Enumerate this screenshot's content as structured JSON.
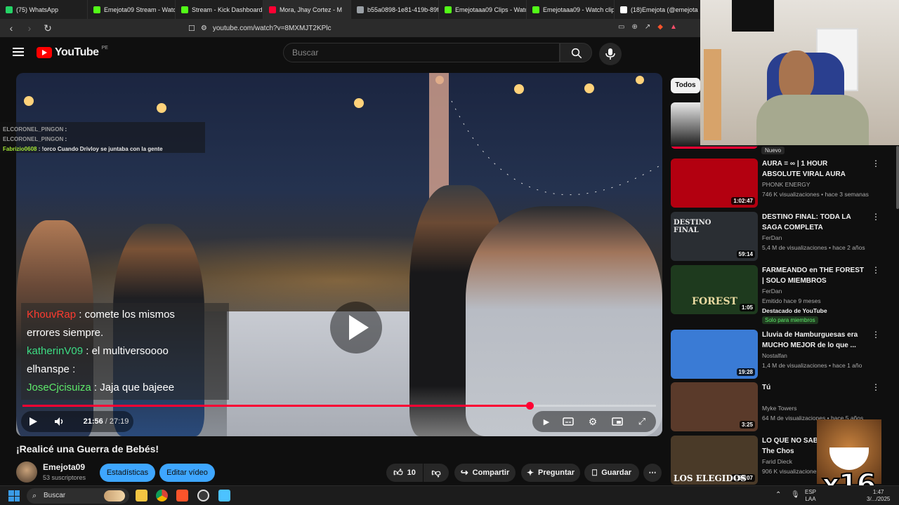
{
  "browser": {
    "tabs": [
      {
        "label": "(75) WhatsApp",
        "color": "#25d366"
      },
      {
        "label": "Emejota09 Stream - Watch",
        "color": "#53fc18"
      },
      {
        "label": "Stream - Kick Dashboard",
        "color": "#53fc18"
      },
      {
        "label": "Mora, Jhay Cortez - M",
        "color": "#ff0033"
      },
      {
        "label": "b55a0898-1e81-419b-89f",
        "color": "#9aa0a6"
      },
      {
        "label": "Emejotaaa09 Clips - Watch",
        "color": "#53fc18"
      },
      {
        "label": "Emejotaaa09 - Watch clip",
        "color": "#53fc18"
      },
      {
        "label": "(18)Emejota (@emejota",
        "color": "#ffffff"
      }
    ],
    "url": "youtube.com/watch?v=8MXMJT2KPlc"
  },
  "youtube": {
    "logo_text": "YouTube",
    "country_code": "PE",
    "search_placeholder": "Buscar"
  },
  "player": {
    "current_time": "21:56",
    "total_time": "27:19",
    "progress": 0.8,
    "time_separator": "/"
  },
  "overlay_chat_small": [
    {
      "user": "ELCORONEL_PINGON",
      "text": ":",
      "color": "#9b9b9b"
    },
    {
      "user": "ELCORONEL_PINGON",
      "text": ":",
      "color": "#9b9b9b"
    },
    {
      "user": "Fabrizio0608",
      "text": ": !orco Cuando Drivloy se juntaba con la gente",
      "color": "#a3e635"
    }
  ],
  "overlay_chat_big": [
    {
      "user": "KhouvRap",
      "text": ": comete los mismos",
      "color": "#ff3b30"
    },
    {
      "user": "",
      "text": "errores siempre.",
      "color": "#ffffff"
    },
    {
      "user": "katherinV09",
      "text": ": el multiversoooo",
      "color": "#3ddc84"
    },
    {
      "user": "elhanspe",
      "text": ":",
      "color": "#ffffff"
    },
    {
      "user": "JoseCjcisuiza",
      "text": ": Jaja que bajeee",
      "color": "#5ee86a"
    }
  ],
  "video": {
    "title": "¡Realicé una Guerra de Bebés!",
    "channel": "Emejota09",
    "subscribers": "53 suscriptores",
    "stats_button": "Estadísticas",
    "edit_button": "Editar vídeo",
    "likes": "10",
    "share_label": "Compartir",
    "ask_label": "Preguntar",
    "save_label": "Guardar"
  },
  "sidebar": {
    "chip": "Todos",
    "new_badge": "Nuevo",
    "items": [
      {
        "title": "AURA = ∞ | 1 HOUR ABSOLUTE VIRAL AURA MUSI...",
        "channel": "PHONK ENERGY",
        "meta": "746 K visualizaciones • hace 3 semanas",
        "duration": "1:02:47",
        "thumb": "#b30010"
      },
      {
        "title": "DESTINO FINAL: TODA LA SAGA COMPLETA",
        "channel": "FerDan",
        "meta": "5,4 M de visualizaciones • hace 2 años",
        "duration": "59:14",
        "thumb": "#2a2e33"
      },
      {
        "title": "FARMEANDO en THE FOREST | SOLO MIEMBROS",
        "channel": "FerDan",
        "meta": "Emitido hace 9 meses",
        "duration": "1:05",
        "thumb": "#1e3a1e",
        "extra": "Destacado de YouTube",
        "badge": "Solo para miembros"
      },
      {
        "title": "Lluvia de Hamburguesas era MUCHO MEJOR de lo que ...",
        "channel": "Nostalfan",
        "meta": "1,4 M de visualizaciones • hace 1 año",
        "duration": "19:28",
        "thumb": "#3a7bd5"
      },
      {
        "title": "Tú",
        "channel": "Myke Towers",
        "meta": "64 M de visualizaciones • hace 5 años",
        "duration": "3:25",
        "thumb": "#5a3a2a"
      },
      {
        "title": "LO QUE NO SABÍA JESÚS | The Chos",
        "channel": "Farid Dieck",
        "meta": "906 K visualizaciones",
        "duration": "1:53:07",
        "thumb": "#4a3a28"
      }
    ],
    "thumb_label_destino": "DESTINO FINAL",
    "thumb_label_forest": "FOREST",
    "thumb_label_elegidos": "LOS ELEGIDOS"
  },
  "overlay": {
    "multiplier": "x16"
  },
  "taskbar": {
    "search_label": "Buscar",
    "lang": "ESP",
    "layout": "LAA",
    "time": "1:47",
    "date": "3/.../2025"
  }
}
